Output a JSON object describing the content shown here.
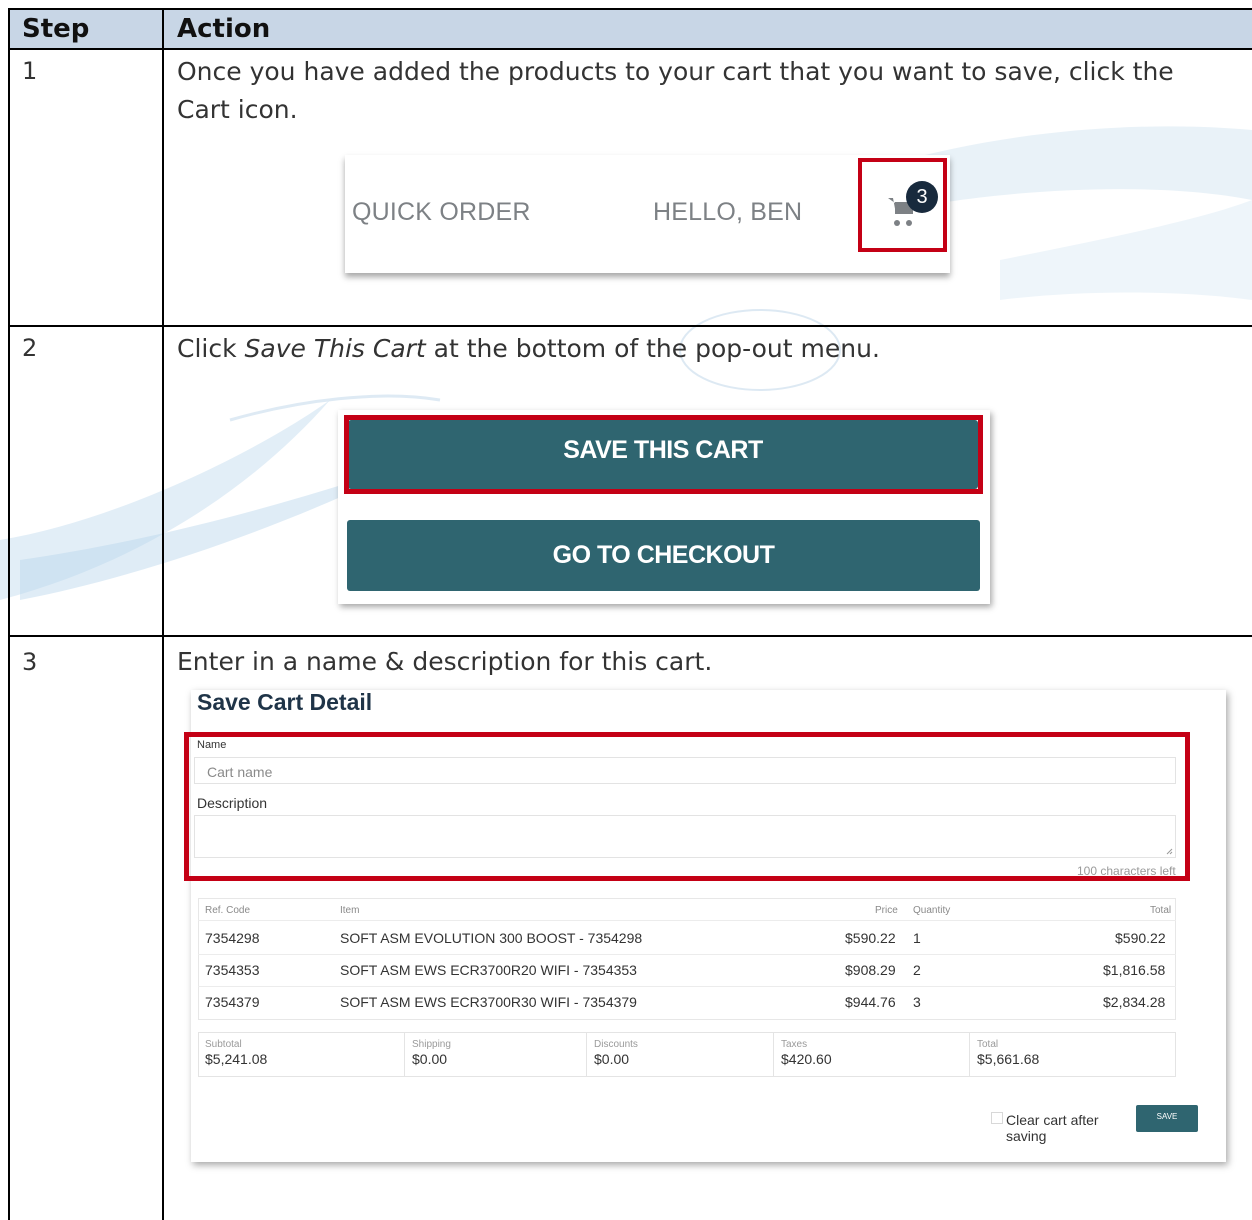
{
  "header": {
    "step_col": "Step",
    "action_col": "Action"
  },
  "rows": [
    {
      "step": "1",
      "instruction": "Once you have added the products to your cart that you want to save, click the Cart icon.",
      "nav": {
        "quick_order": "QUICK ORDER",
        "greeting": "HELLO, BEN",
        "cart_count": "3",
        "cart_icon": "shopping-cart-icon"
      }
    },
    {
      "step": "2",
      "instruction_pre": "Click ",
      "instruction_em": "Save This Cart",
      "instruction_post": " at the bottom of the pop-out menu.",
      "buttons": {
        "save": "SAVE THIS CART",
        "checkout": "GO TO CHECKOUT"
      }
    },
    {
      "step": "3",
      "instruction": "Enter in a name & description for this cart.",
      "form": {
        "title": "Save Cart Detail",
        "name_label": "Name",
        "name_placeholder": "Cart name",
        "description_label": "Description",
        "chars_left": "100 characters left",
        "columns": {
          "ref": "Ref. Code",
          "item": "Item",
          "price": "Price",
          "qty": "Quantity",
          "total": "Total"
        },
        "items": [
          {
            "ref": "7354298",
            "item": "SOFT ASM EVOLUTION 300 BOOST - 7354298",
            "price": "$590.22",
            "qty": "1",
            "total": "$590.22"
          },
          {
            "ref": "7354353",
            "item": "SOFT ASM EWS ECR3700R20 WIFI - 7354353",
            "price": "$908.29",
            "qty": "2",
            "total": "$1,816.58"
          },
          {
            "ref": "7354379",
            "item": "SOFT ASM EWS ECR3700R30 WIFI - 7354379",
            "price": "$944.76",
            "qty": "3",
            "total": "$2,834.28"
          }
        ],
        "totals": {
          "subtotal_label": "Subtotal",
          "subtotal": "$5,241.08",
          "shipping_label": "Shipping",
          "shipping": "$0.00",
          "discounts_label": "Discounts",
          "discounts": "$0.00",
          "taxes_label": "Taxes",
          "taxes": "$420.60",
          "total_label": "Total",
          "total": "$5,661.68"
        },
        "clear_cart_label": "Clear cart after saving",
        "save_label": "SAVE"
      }
    }
  ],
  "colors": {
    "header_bg": "#c8d6e6",
    "highlight": "#c40015",
    "button": "#2f6570",
    "badge": "#182a3d"
  }
}
